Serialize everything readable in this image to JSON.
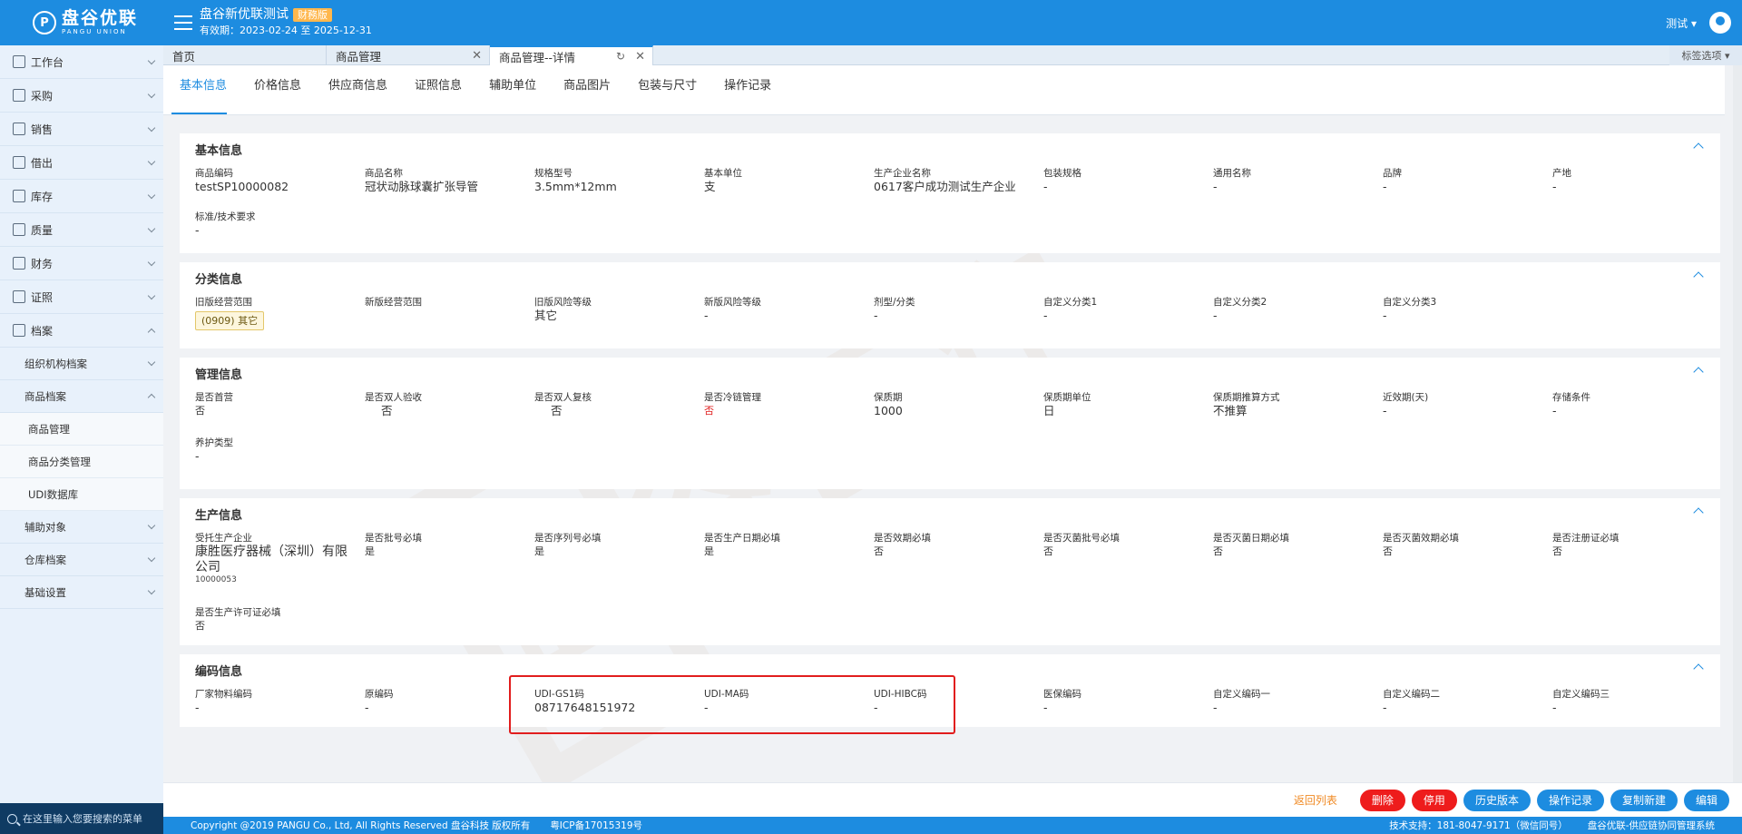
{
  "header": {
    "logo_cn": "盘谷优联",
    "logo_en": "PANGU UNION",
    "company": "盘谷新优联测试",
    "badge": "财務版",
    "valid": "有效期：2023-02-24 至 2025-12-31",
    "user": "测试 ▾"
  },
  "sidebar": {
    "items": [
      {
        "label": "工作台"
      },
      {
        "label": "采购"
      },
      {
        "label": "销售"
      },
      {
        "label": "借出"
      },
      {
        "label": "库存"
      },
      {
        "label": "质量"
      },
      {
        "label": "财务"
      },
      {
        "label": "证照"
      },
      {
        "label": "档案"
      }
    ],
    "subs": {
      "org": "组织机构档案",
      "goods": "商品档案",
      "goods_mgmt": "商品管理",
      "goods_cat": "商品分类管理",
      "udi": "UDI数据库",
      "aux": "辅助对象",
      "warehouse": "仓库档案",
      "basic": "基础设置"
    },
    "search_placeholder": "在这里输入您要搜索的菜单"
  },
  "tabs": [
    {
      "label": "首页"
    },
    {
      "label": "商品管理"
    },
    {
      "label": "商品管理--详情"
    }
  ],
  "tab_options": "标签选项 ▾",
  "detail_tabs": [
    "基本信息",
    "价格信息",
    "供应商信息",
    "证照信息",
    "辅助单位",
    "商品图片",
    "包装与尺寸",
    "操作记录"
  ],
  "basic": {
    "title": "基本信息",
    "fields": [
      {
        "label": "商品编码",
        "value": "testSP10000082"
      },
      {
        "label": "商品名称",
        "value": "冠状动脉球囊扩张导管"
      },
      {
        "label": "规格型号",
        "value": "3.5mm*12mm"
      },
      {
        "label": "基本单位",
        "value": "支"
      },
      {
        "label": "生产企业名称",
        "value": "0617客户成功测试生产企业"
      },
      {
        "label": "包装规格",
        "value": "-"
      },
      {
        "label": "通用名称",
        "value": "-"
      },
      {
        "label": "品牌",
        "value": "-"
      },
      {
        "label": "产地",
        "value": "-"
      },
      {
        "label": "标准/技术要求",
        "value": "-"
      }
    ]
  },
  "category": {
    "title": "分类信息",
    "fields": [
      {
        "label": "旧版经营范围",
        "value": "(0909) 其它"
      },
      {
        "label": "新版经营范围",
        "value": ""
      },
      {
        "label": "旧版风险等级",
        "value": "其它"
      },
      {
        "label": "新版风险等级",
        "value": "-"
      },
      {
        "label": "剂型/分类",
        "value": "-"
      },
      {
        "label": "自定义分类1",
        "value": "-"
      },
      {
        "label": "自定义分类2",
        "value": "-"
      },
      {
        "label": "自定义分类3",
        "value": "-"
      }
    ]
  },
  "management": {
    "title": "管理信息",
    "fields": [
      {
        "label": "是否首营",
        "value": "否"
      },
      {
        "label": "是否双人验收",
        "value": "否"
      },
      {
        "label": "是否双人复核",
        "value": "否"
      },
      {
        "label": "是否冷链管理",
        "value": "否"
      },
      {
        "label": "保质期",
        "value": "1000"
      },
      {
        "label": "保质期单位",
        "value": "日"
      },
      {
        "label": "保质期推算方式",
        "value": "不推算"
      },
      {
        "label": "近效期(天)",
        "value": "-"
      },
      {
        "label": "存储条件",
        "value": "-"
      },
      {
        "label": "养护类型",
        "value": "-"
      }
    ]
  },
  "production": {
    "title": "生产信息",
    "fields": [
      {
        "label": "受托生产企业",
        "value": "康胜医疗器械（深圳）有限公司",
        "code": "10000053"
      },
      {
        "label": "是否批号必填",
        "value": "是"
      },
      {
        "label": "是否序列号必填",
        "value": "是"
      },
      {
        "label": "是否生产日期必填",
        "value": "是"
      },
      {
        "label": "是否效期必填",
        "value": "否"
      },
      {
        "label": "是否灭菌批号必填",
        "value": "否"
      },
      {
        "label": "是否灭菌日期必填",
        "value": "否"
      },
      {
        "label": "是否灭菌效期必填",
        "value": "否"
      },
      {
        "label": "是否注册证必填",
        "value": "否"
      },
      {
        "label": "是否生产许可证必填",
        "value": "否"
      }
    ]
  },
  "coding": {
    "title": "编码信息",
    "fields": [
      {
        "label": "厂家物料编码",
        "value": "-"
      },
      {
        "label": "原编码",
        "value": "-"
      },
      {
        "label": "UDI-GS1码",
        "value": "08717648151972"
      },
      {
        "label": "UDI-MA码",
        "value": "-"
      },
      {
        "label": "UDI-HIBC码",
        "value": "-"
      },
      {
        "label": "医保编码",
        "value": "-"
      },
      {
        "label": "自定义编码一",
        "value": "-"
      },
      {
        "label": "自定义编码二",
        "value": "-"
      },
      {
        "label": "自定义编码三",
        "value": "-"
      }
    ]
  },
  "actions": {
    "back": "返回列表",
    "delete": "删除",
    "disable": "停用",
    "history": "历史版本",
    "log": "操作记录",
    "copy": "复制新建",
    "edit": "编辑"
  },
  "footer": {
    "copyright": "Copyright @2019 PANGU Co., Ltd, All Rights Reserved 盘谷科技 版权所有",
    "icp": "粤ICP备17015319号",
    "support": "技术支持：181-8047-9171（微信同号）",
    "system": "盘谷优联-供应链协同管理系统"
  },
  "watermark": "盘谷医疗",
  "colors": {
    "primary": "#1d8ce0",
    "danger": "#ee1c1c",
    "highlight": "#e11d1d",
    "link": "#f08a24"
  }
}
